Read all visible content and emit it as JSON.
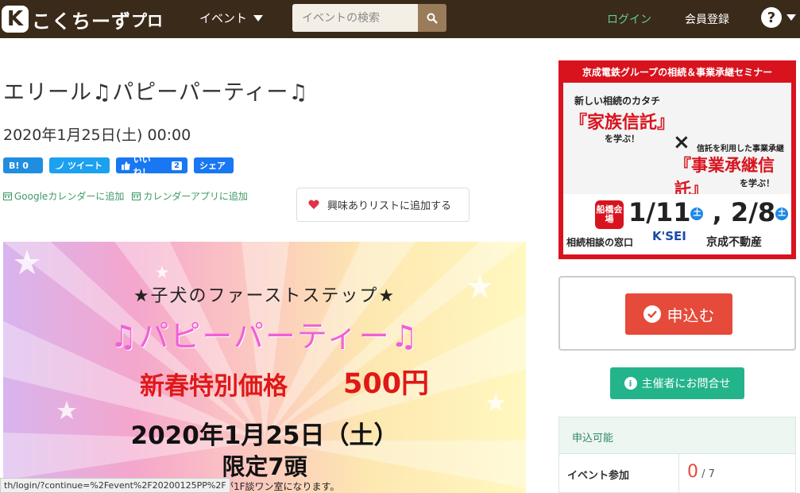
{
  "header": {
    "logo_mark": "K",
    "logo_text": "こくちーず",
    "logo_pro": "プロ",
    "nav_event": "イベント",
    "search_placeholder": "イベントの検索",
    "login": "ログイン",
    "register": "会員登録",
    "help": "?"
  },
  "event": {
    "title": "エリール♫パピーパーティー♫",
    "date": "2020年1月25日(土) 00:00",
    "social": {
      "hatena": "B! 0",
      "tweet": "ツイート",
      "like": "いいね！",
      "like_count": "2",
      "share": "シェア"
    },
    "calendar": {
      "google": "Googleカレンダーに追加",
      "app": "カレンダーアプリに追加"
    },
    "favorite": "興味ありリストに追加する"
  },
  "image": {
    "subtitle": "★子犬のファーストステップ★",
    "title": "♫パピーパーティー♫",
    "price_label": "新春特別価格",
    "price": "500円",
    "date": "2020年1月25日（土）",
    "limit": "限定7頭",
    "note": "開催場所が1F談ワン室になります。"
  },
  "status_url": "th/login/?continue=%2Fevent%2F20200125PP%2F",
  "ad": {
    "top": "京成電鉄グループの相続＆事業承継セミナー",
    "t1": "新しい相続のカタチ",
    "t2": "『家族信託』",
    "t3": "を学ぶ！",
    "x": "×",
    "t4": "信託を利用した事業承継",
    "t5": "『事業承継信託』",
    "t6": "を学ぶ！",
    "venue": "船橋会場",
    "date1": "1/11",
    "date2": "2/8",
    "sat": "土",
    "window": "相続相談の窓口",
    "kisei": "K'SEI",
    "group_label": "京成電鉄グループ",
    "fudosan": "京成不動産"
  },
  "apply": {
    "button": "申込む"
  },
  "contact": {
    "button": "主催者にお問合せ"
  },
  "status": {
    "head": "申込可能",
    "label": "イベント参加",
    "count": "0",
    "capacity": "/ 7"
  },
  "colors": {
    "header_bg": "#3a2a1a",
    "login": "#5fd08a",
    "apply": "#e64a3a",
    "contact": "#23b48c"
  }
}
